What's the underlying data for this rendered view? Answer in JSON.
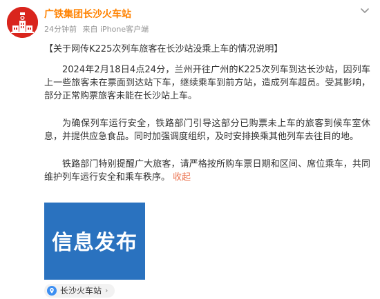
{
  "post": {
    "account_name": "广铁集团长沙火车站",
    "time": "24分钟前",
    "source": "来自 iPhone客户端",
    "headline": "【关于网传K225次列车旅客在长沙站没乘上车的情况说明】",
    "paragraphs": [
      "2024年2月18日4点24分，兰州开往广州的K225次列车到达长沙站，因列车上一些旅客未在票面到达站下车，继续乘车到前方站，造成列车超员。受其影响，部分正常购票旅客未能在长沙站上车。",
      "为确保列车运行安全，铁路部门引导这部分已购票未上车的旅客到候车室休息，并提供应急食品。同时加强调度组织，及时安排换乘其他列车去往目的地。",
      "铁路部门特别提醒广大旅客，请严格按所购车票日期和区间、席位乘车，共同维护列车运行安全和乘车秩序。"
    ],
    "collapse_label": "收起",
    "image_text": "信息发布",
    "location": "长沙火车站",
    "location_arrow": "›"
  },
  "colors": {
    "account_name": "#ff8200",
    "collapse_link": "#eb7350",
    "avatar_bg": "#d9251d",
    "image_bg": "#2a72bf",
    "location_pin": "#3d8ff2"
  },
  "icons": {
    "avatar": "railway-station-logo",
    "menu": "chevron-down-icon",
    "location": "location-pin-icon"
  }
}
